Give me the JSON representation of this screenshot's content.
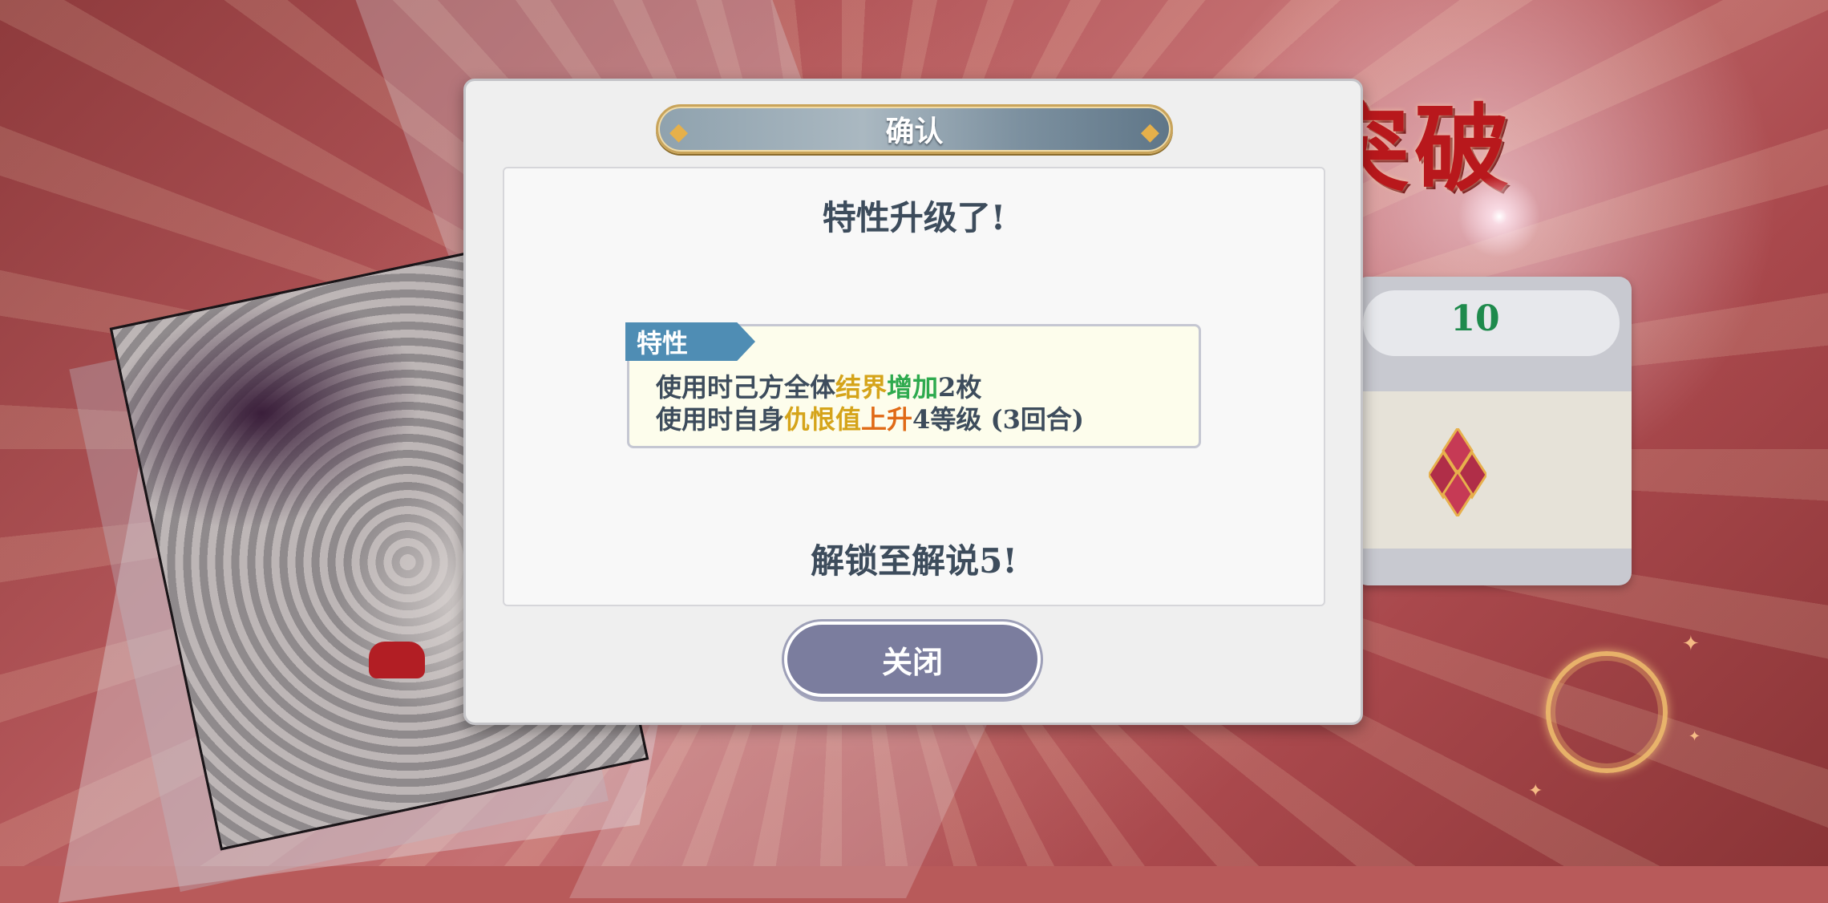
{
  "background": {
    "title_text": "突破",
    "side_panel": {
      "value": "10",
      "value_color": "#1e8a4c"
    }
  },
  "dialog": {
    "title": "确认",
    "headline": "特性升级了!",
    "trait": {
      "tag": "特性",
      "line1": [
        {
          "text": "使用时己方全体",
          "color": "default"
        },
        {
          "text": "结界",
          "color": "#d5a41a"
        },
        {
          "text": "增加",
          "color": "#2eaa4e"
        },
        {
          "text": "2枚",
          "color": "default"
        }
      ],
      "line2": [
        {
          "text": "使用时自身",
          "color": "default"
        },
        {
          "text": "仇恨值",
          "color": "#d5a41a"
        },
        {
          "text": "上升",
          "color": "#e06a16"
        },
        {
          "text": "4等级 (3回合)",
          "color": "default"
        }
      ]
    },
    "unlock_text": "解锁至解说5!",
    "close_label": "关闭"
  },
  "colors": {
    "text_primary": "#3d4c5c",
    "trait_tag": "#4f8db4",
    "close_button": "#7b7d9e",
    "title_gold": "#c9a45a"
  }
}
